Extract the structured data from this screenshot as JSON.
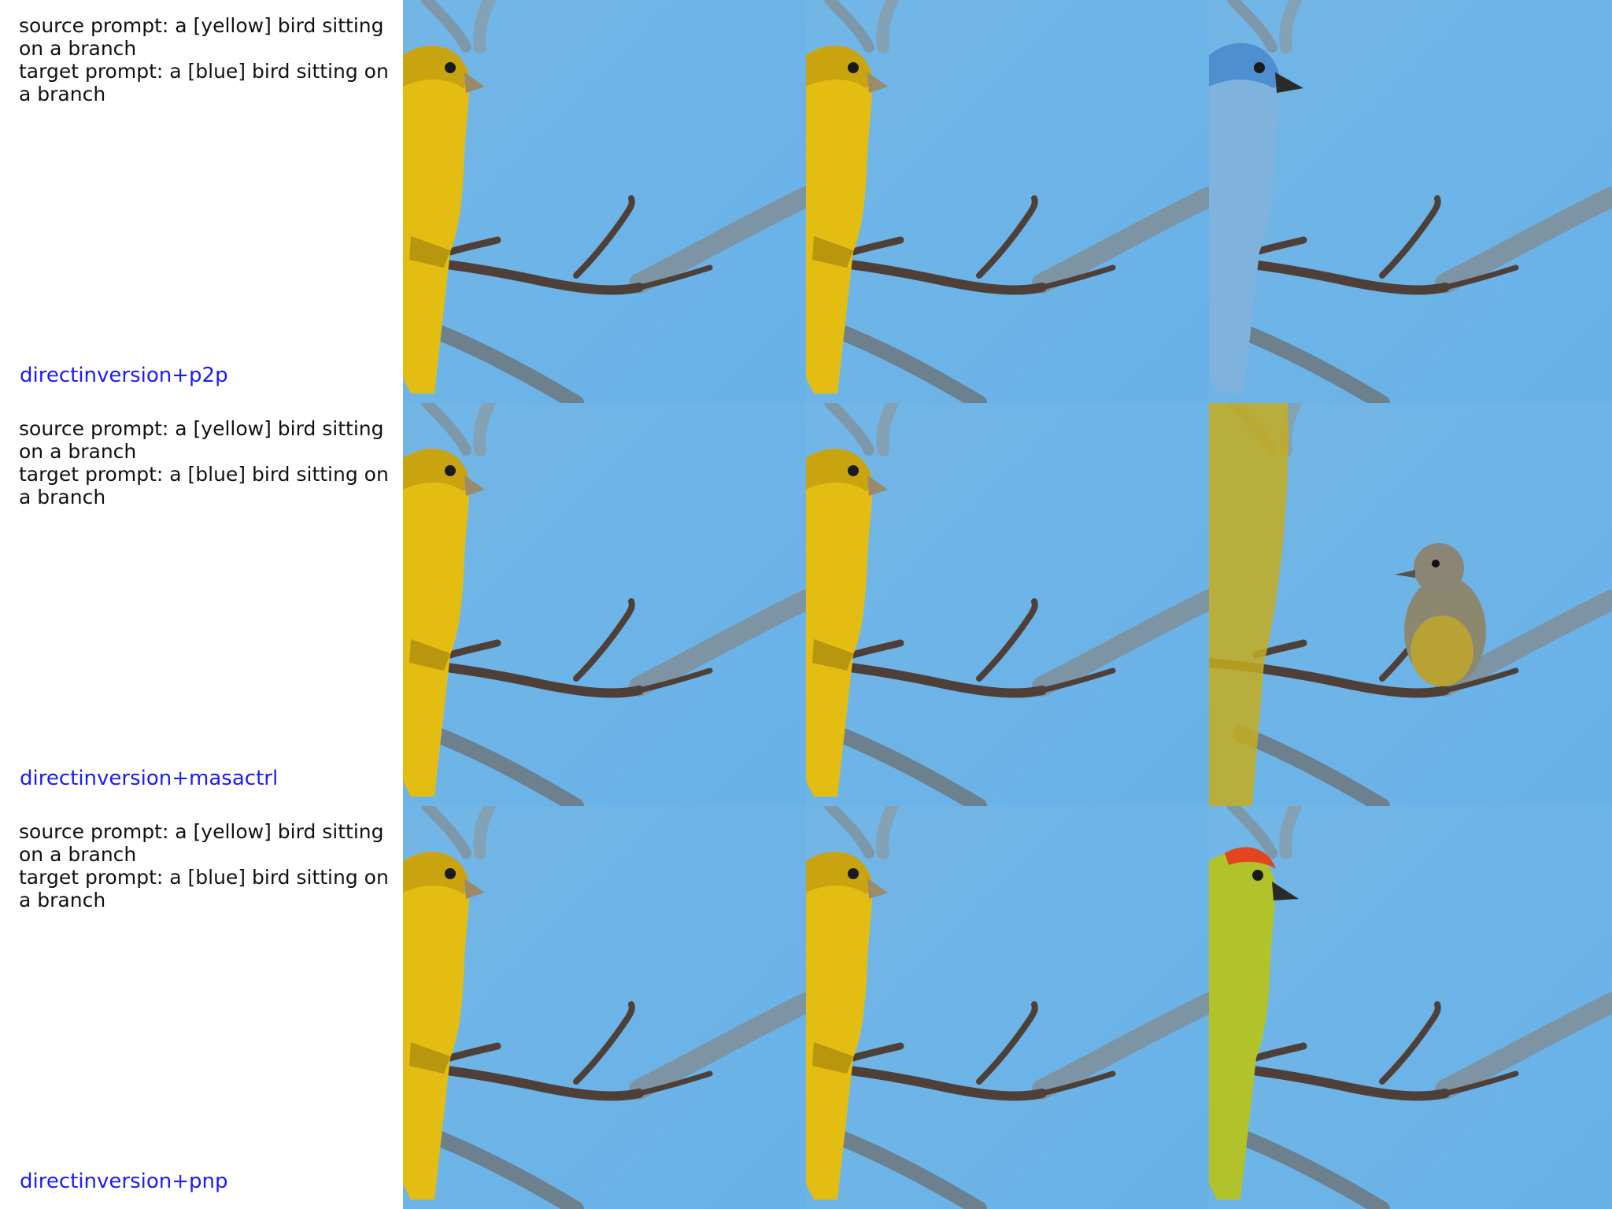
{
  "rows": [
    {
      "source_prompt": "source prompt: a [yellow] bird sitting on a branch",
      "target_prompt": "target prompt: a [blue] bird sitting on a branch",
      "method": "directinversion+p2p"
    },
    {
      "source_prompt": "source prompt: a [yellow] bird sitting on a branch",
      "target_prompt": "target prompt: a [blue] bird sitting on a branch",
      "method": "directinversion+masactrl"
    },
    {
      "source_prompt": "source prompt: a [yellow] bird sitting on a branch",
      "target_prompt": "target prompt: a [blue] bird sitting on a branch",
      "method": "directinversion+pnp"
    }
  ],
  "colors": {
    "sky": "#6cb4e6",
    "branch": "#5a4a3e",
    "yellow_bird": "#e6c014",
    "blue_bird": "#6aa6d6",
    "method_label": "#1a1aff"
  }
}
